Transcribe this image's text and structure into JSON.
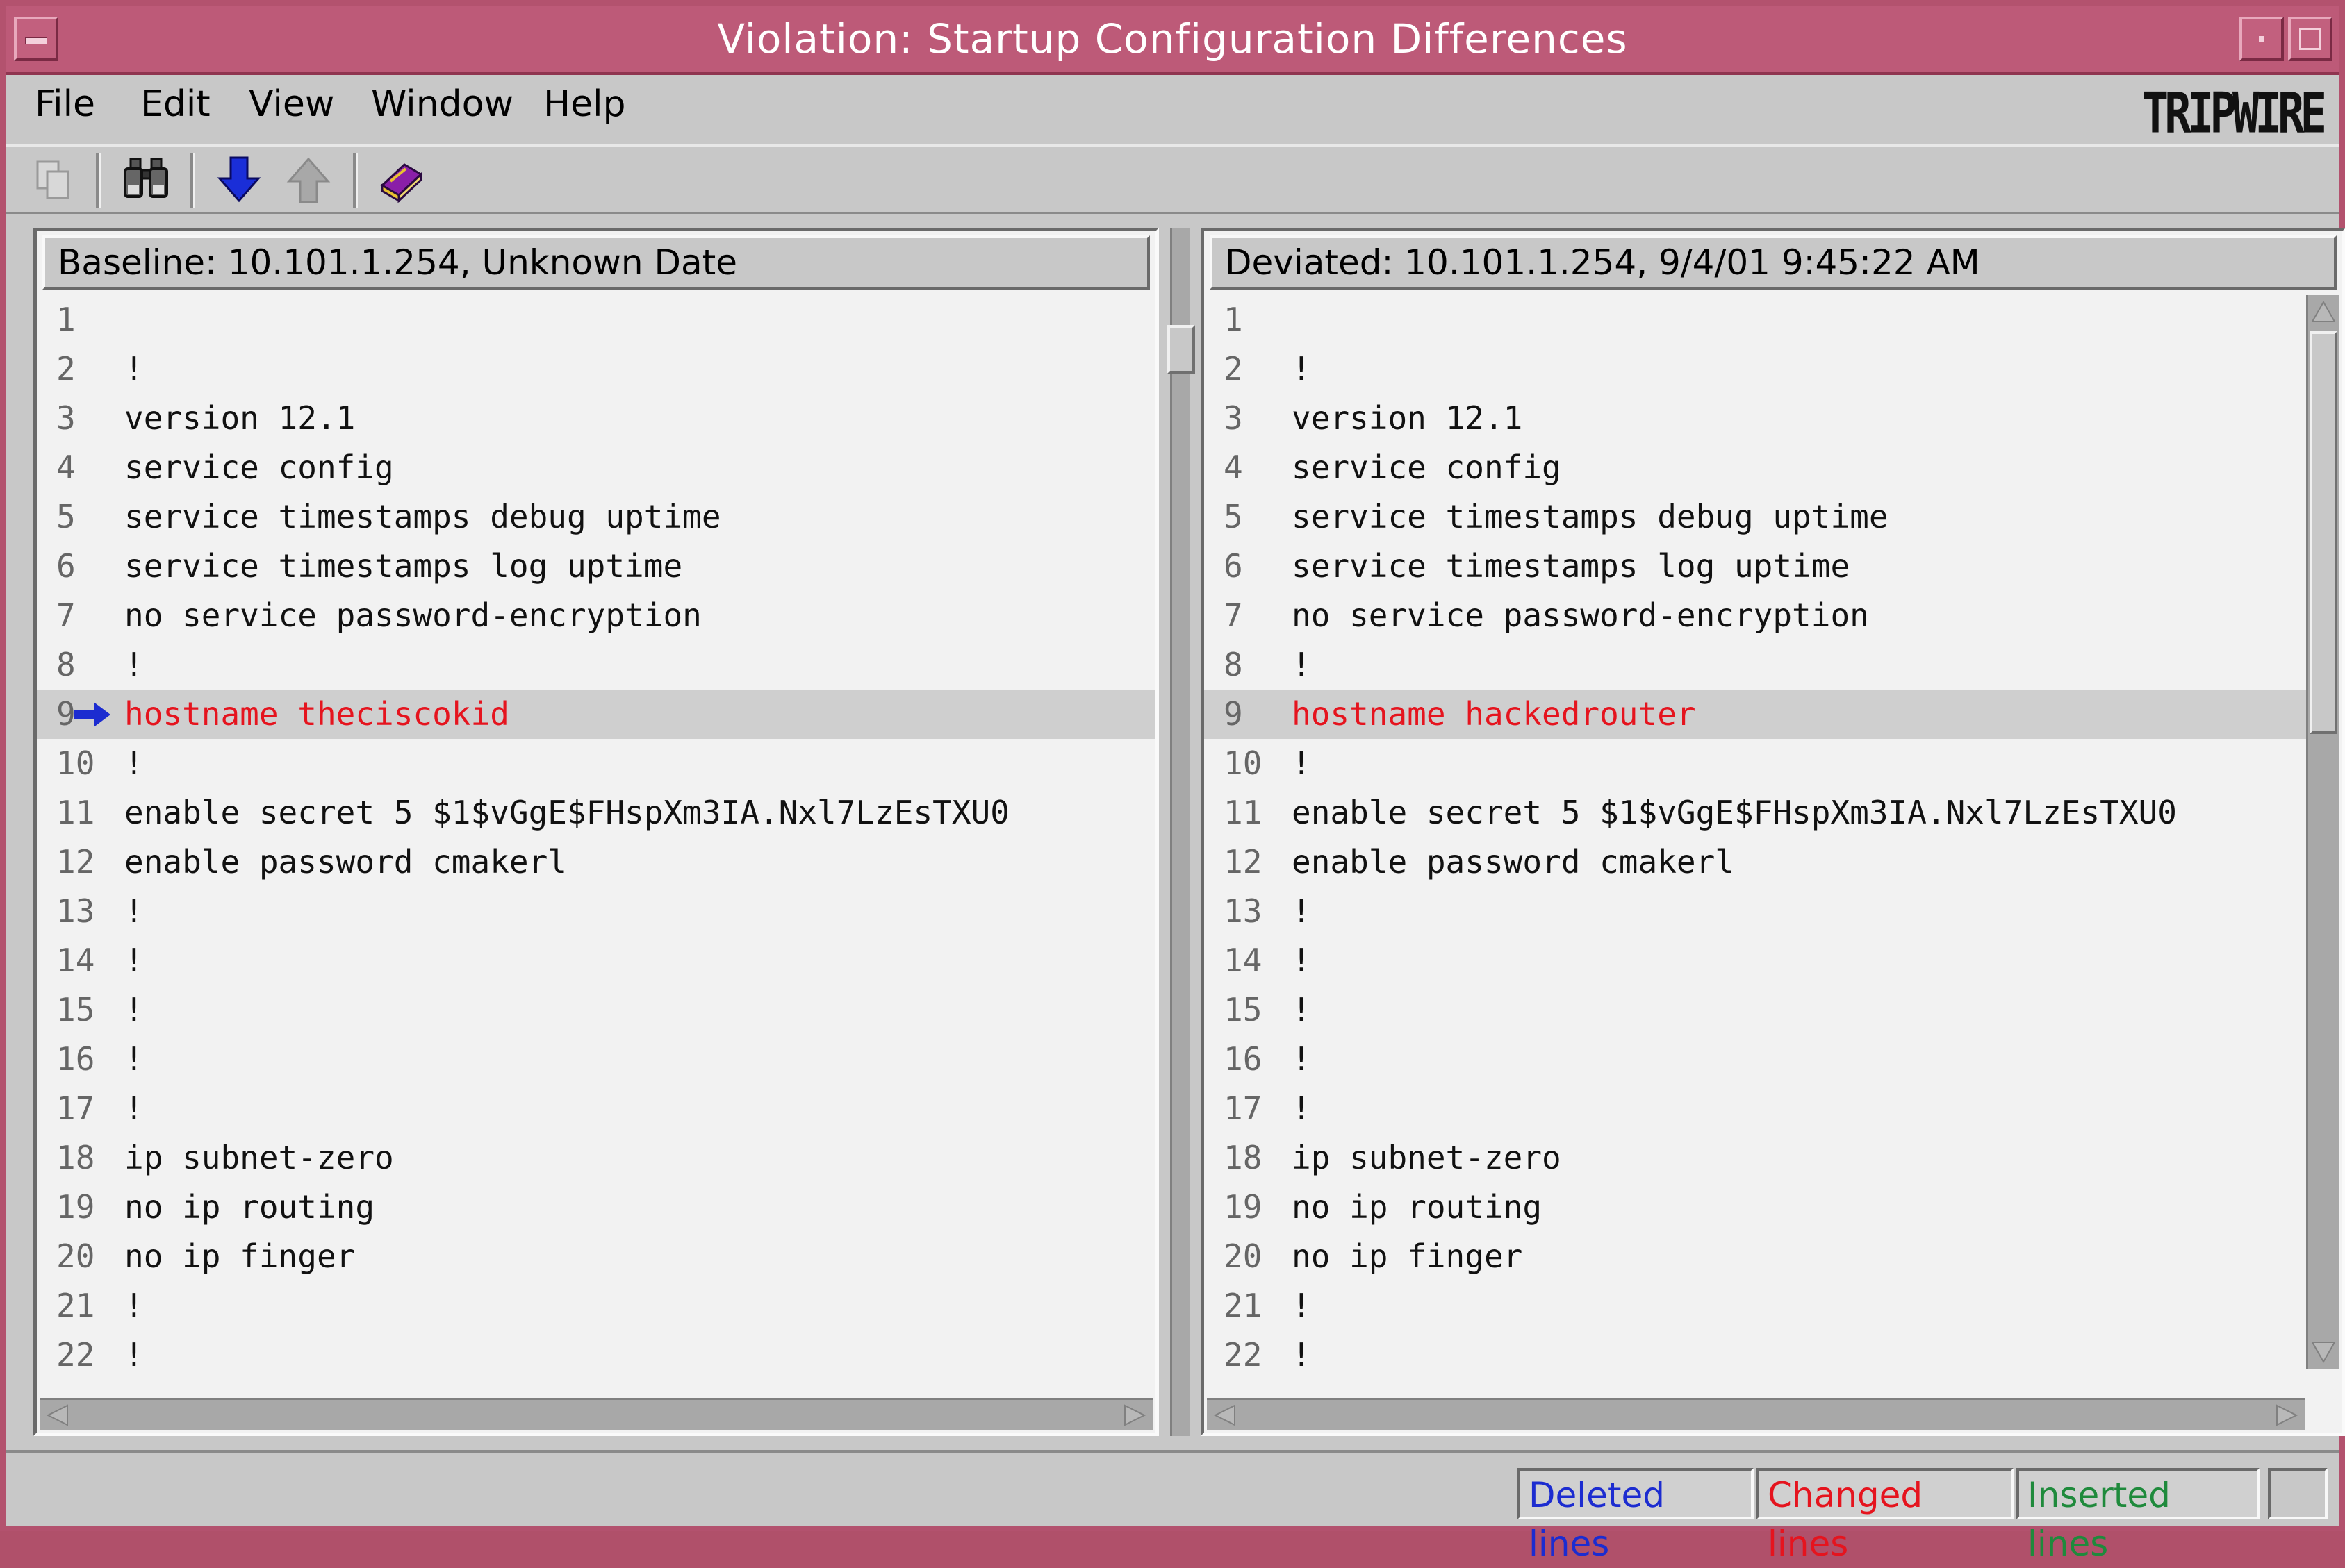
{
  "window": {
    "title": "Violation: Startup Configuration Differences"
  },
  "logo": "TRIPWIRE",
  "menu": [
    "File",
    "Edit",
    "View",
    "Window",
    "Help"
  ],
  "toolbar": [
    {
      "icon": "copy-icon",
      "enabled": false
    },
    {
      "icon": "binoculars-find-icon",
      "enabled": true
    },
    {
      "icon": "next-difference-down-arrow-icon",
      "enabled": true
    },
    {
      "icon": "previous-difference-up-arrow-icon",
      "enabled": false
    },
    {
      "icon": "book-help-icon",
      "enabled": true
    }
  ],
  "left_pane": {
    "header": "Baseline: 10.101.1.254, Unknown Date",
    "lines": [
      {
        "n": "1",
        "text": ""
      },
      {
        "n": "2",
        "text": "!"
      },
      {
        "n": "3",
        "text": "version 12.1"
      },
      {
        "n": "4",
        "text": "service config"
      },
      {
        "n": "5",
        "text": "service timestamps debug uptime"
      },
      {
        "n": "6",
        "text": "service timestamps log uptime"
      },
      {
        "n": "7",
        "text": "no service password-encryption"
      },
      {
        "n": "8",
        "text": "!"
      },
      {
        "n": "9",
        "text": "hostname theciscokid",
        "changed": true,
        "marker": true
      },
      {
        "n": "10",
        "text": "!"
      },
      {
        "n": "11",
        "text": "enable secret 5 $1$vGgE$FHspXm3IA.Nxl7LzEsTXU0"
      },
      {
        "n": "12",
        "text": "enable password cmakerl"
      },
      {
        "n": "13",
        "text": "!"
      },
      {
        "n": "14",
        "text": "!"
      },
      {
        "n": "15",
        "text": "!"
      },
      {
        "n": "16",
        "text": "!"
      },
      {
        "n": "17",
        "text": "!"
      },
      {
        "n": "18",
        "text": "ip subnet-zero"
      },
      {
        "n": "19",
        "text": "no ip routing"
      },
      {
        "n": "20",
        "text": "no ip finger"
      },
      {
        "n": "21",
        "text": "!"
      },
      {
        "n": "22",
        "text": "!"
      }
    ]
  },
  "right_pane": {
    "header": "Deviated: 10.101.1.254, 9/4/01 9:45:22 AM",
    "lines": [
      {
        "n": "1",
        "text": ""
      },
      {
        "n": "2",
        "text": "!"
      },
      {
        "n": "3",
        "text": "version 12.1"
      },
      {
        "n": "4",
        "text": "service config"
      },
      {
        "n": "5",
        "text": "service timestamps debug uptime"
      },
      {
        "n": "6",
        "text": "service timestamps log uptime"
      },
      {
        "n": "7",
        "text": "no service password-encryption"
      },
      {
        "n": "8",
        "text": "!"
      },
      {
        "n": "9",
        "text": "hostname hackedrouter",
        "changed": true
      },
      {
        "n": "10",
        "text": "!"
      },
      {
        "n": "11",
        "text": "enable secret 5 $1$vGgE$FHspXm3IA.Nxl7LzEsTXU0"
      },
      {
        "n": "12",
        "text": "enable password cmakerl"
      },
      {
        "n": "13",
        "text": "!"
      },
      {
        "n": "14",
        "text": "!"
      },
      {
        "n": "15",
        "text": "!"
      },
      {
        "n": "16",
        "text": "!"
      },
      {
        "n": "17",
        "text": "!"
      },
      {
        "n": "18",
        "text": "ip subnet-zero"
      },
      {
        "n": "19",
        "text": "no ip routing"
      },
      {
        "n": "20",
        "text": "no ip finger"
      },
      {
        "n": "21",
        "text": "!"
      },
      {
        "n": "22",
        "text": "!"
      }
    ]
  },
  "legend": {
    "deleted": "Deleted lines",
    "changed": "Changed lines",
    "inserted": "Inserted lines"
  },
  "colors": {
    "titlebar": "#bd5a78",
    "deleted": "#1c2cd0",
    "changed": "#e5141e",
    "inserted": "#1f8a3c",
    "marker": "#1c2cd0"
  }
}
